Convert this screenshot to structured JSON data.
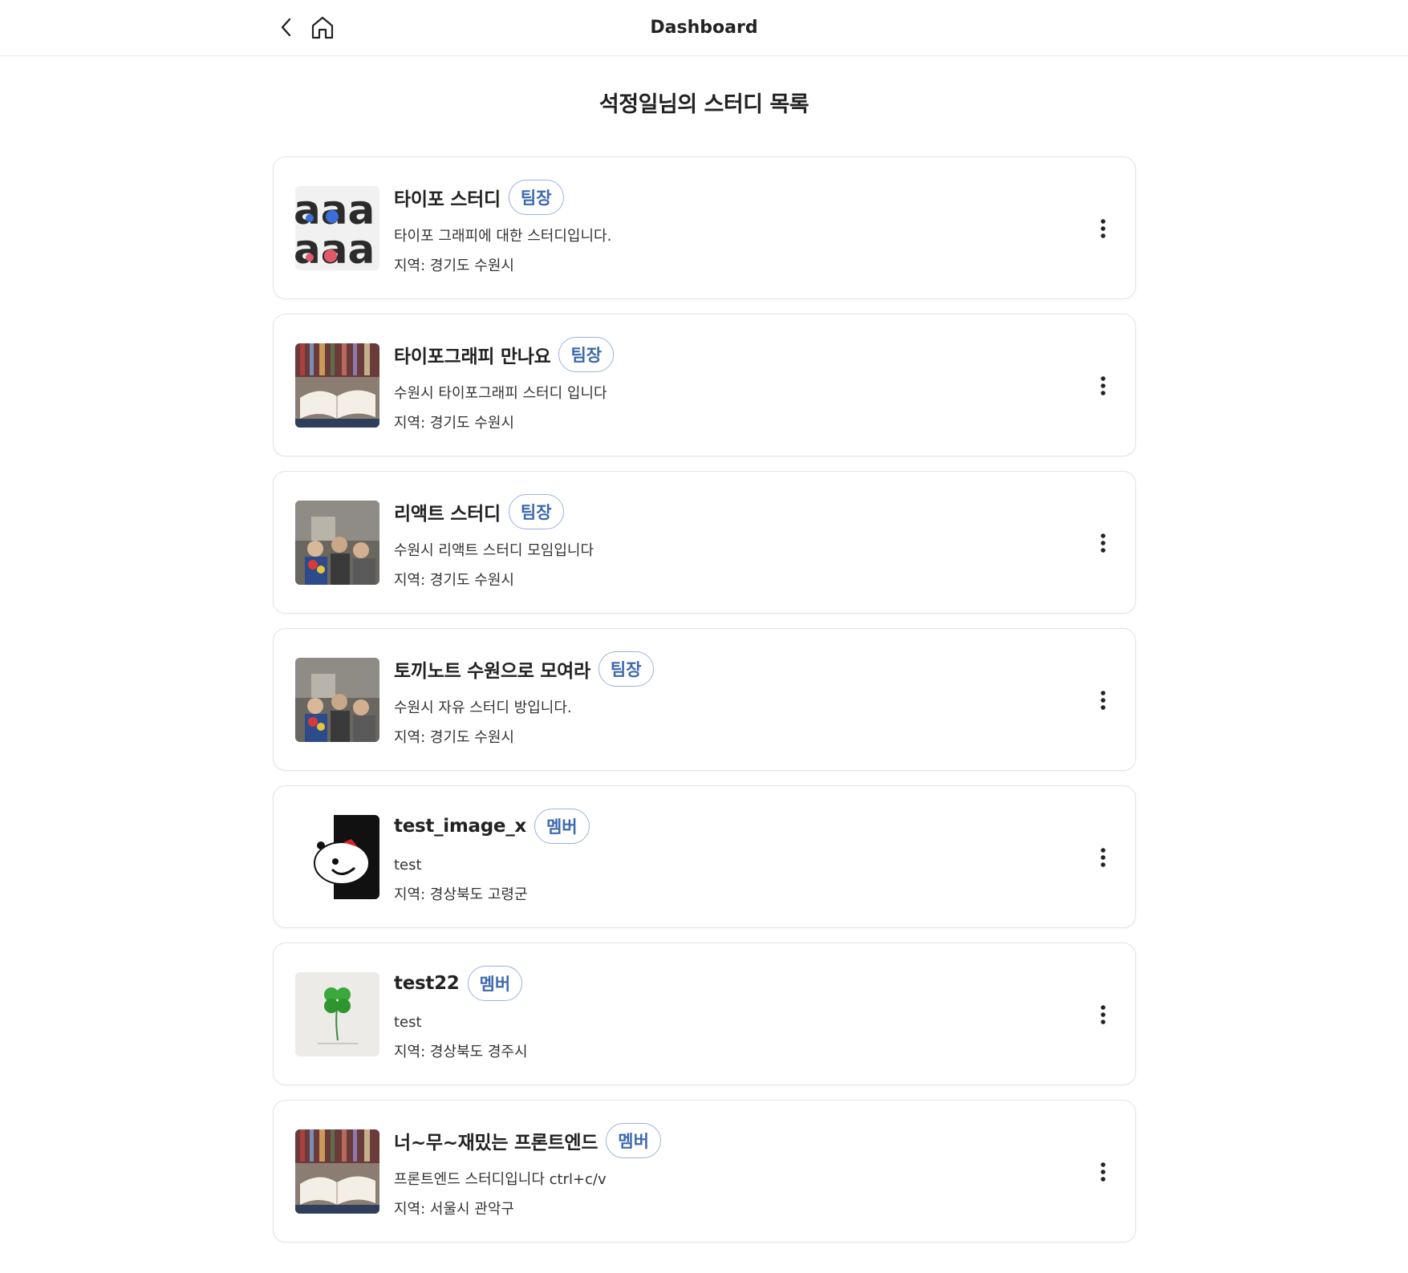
{
  "header": {
    "title": "Dashboard",
    "back_icon": "chevron-left-icon",
    "home_icon": "home-icon"
  },
  "page": {
    "title": "석정일님의 스터디 목록"
  },
  "colors": {
    "badge_text": "#3d68b0",
    "badge_border": "#9bb3db",
    "card_border": "#e3e3e3"
  },
  "studies": [
    {
      "name": "타이포 스터디",
      "role": "팀장",
      "description": "타이포 그래피에 대한 스터디입니다.",
      "region": "지역: 경기도 수원시",
      "thumbnail": "typography-letters-image"
    },
    {
      "name": "타이포그래피 만나요",
      "role": "팀장",
      "description": "수원시 타이포그래피 스터디 입니다",
      "region": "지역: 경기도 수원시",
      "thumbnail": "open-book-image"
    },
    {
      "name": "리액트 스터디",
      "role": "팀장",
      "description": "수원시 리액트 스터디 모임입니다",
      "region": "지역: 경기도 수원시",
      "thumbnail": "group-photo-image"
    },
    {
      "name": "토끼노트 수원으로 모여라",
      "role": "팀장",
      "description": "수원시 자유 스터디 방입니다.",
      "region": "지역: 경기도 수원시",
      "thumbnail": "group-photo-image"
    },
    {
      "name": "test_image_x",
      "role": "멤버",
      "description": "test",
      "region": "지역: 경상북도 고령군",
      "thumbnail": "bear-mascot-image"
    },
    {
      "name": "test22",
      "role": "멤버",
      "description": "test",
      "region": "지역: 경상북도 경주시",
      "thumbnail": "clover-image"
    },
    {
      "name": "너~무~재밌는 프론트엔드",
      "role": "멤버",
      "description": "프론트엔드 스터디입니다 ctrl+c/v",
      "region": "지역: 서울시 관악구",
      "thumbnail": "open-book-image"
    }
  ]
}
